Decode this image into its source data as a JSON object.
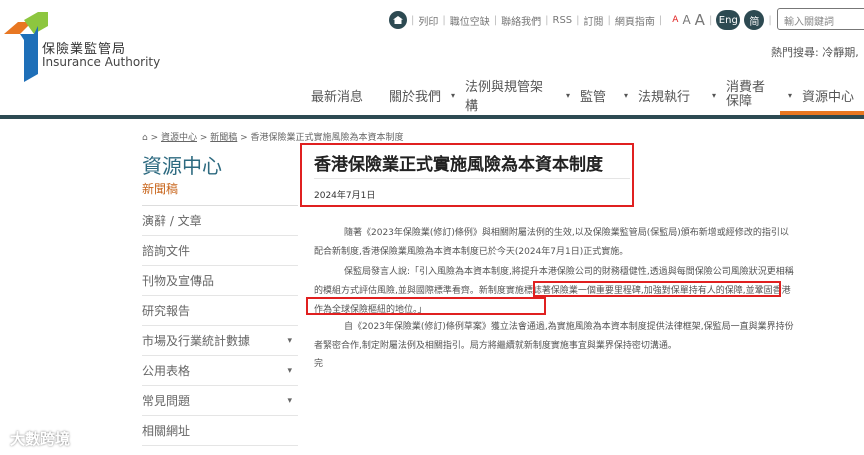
{
  "logo": {
    "zh": "保險業監管局",
    "en": "Insurance Authority"
  },
  "toplinks": [
    "列印",
    "職位空缺",
    "聯絡我們",
    "RSS",
    "訂閱",
    "網頁指南"
  ],
  "font_sizes": [
    "A",
    "A",
    "A"
  ],
  "lang": {
    "eng": "Eng",
    "simp": "简"
  },
  "search": {
    "placeholder": "輸入關鍵詞"
  },
  "hot_search": "熱門搜尋: 冷靜期,",
  "nav": [
    "最新消息",
    "關於我們",
    "法例與規管架構",
    "監管",
    "法規執行",
    "消費者保障",
    "資源中心"
  ],
  "breadcrumb": [
    "資源中心",
    "新聞稿",
    "香港保險業正式實施風險為本資本制度"
  ],
  "sidebar": {
    "title": "資源中心",
    "items": [
      "新聞稿",
      "演辭 / 文章",
      "諮詢文件",
      "刊物及宣傳品",
      "研究報告",
      "市場及行業統計數據",
      "公用表格",
      "常見問題",
      "相關網址"
    ]
  },
  "article": {
    "title": "香港保險業正式實施風險為本資本制度",
    "date": "2024年7月1日",
    "p1": "隨著《2023年保險業(修訂)條例》與相關附屬法例的生效,以及保險業監管局(保監局)頒布新增或經修改的指引以配合新制度,香港保險業風險為本資本制度已於今天(2024年7月1日)正式實施。",
    "p2": "保監局發言人說:「引入風險為本資本制度,將提升本港保險公司的財務穩健性,透過與每間保險公司風險狀況更相稱的模組方式評估風險,並與國際標準看齊。新制度實施標誌著保險業一個重要里程碑,加強對保單持有人的保障,並鞏固香港作為全球保險樞紐的地位。」",
    "p3": "自《2023年保險業(修訂)條例草案》獲立法會通過,為實施風險為本資本制度提供法律框架,保監局一直與業界持份者緊密合作,制定附屬法例及相關指引。局方將繼續就新制度實施事宜與業界保持密切溝通。",
    "end": "完"
  },
  "watermark": "大數跨境",
  "colors": {
    "accent": "#e87722",
    "dark": "#2d4a52",
    "highlight": "#e02020"
  }
}
